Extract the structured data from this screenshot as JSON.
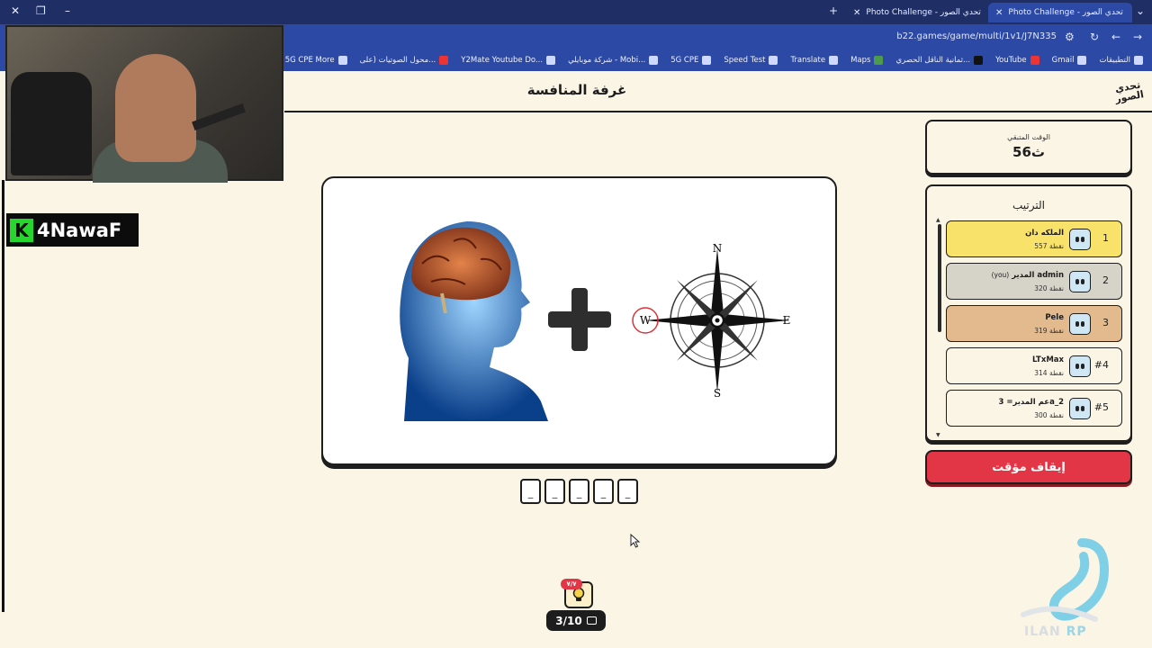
{
  "browser": {
    "tabs": [
      {
        "title": "Photo Challenge - تحدي الصور",
        "active": false
      },
      {
        "title": "Photo Challenge - تحدي الصور",
        "active": true
      }
    ],
    "url": "b22.games/game/multi/1v1/J7N335",
    "bookmarks": [
      "التطبيقات",
      "Gmail",
      "YouTube",
      "ثمانية الناقل الحصري...",
      "Maps",
      "Translate",
      "Speed Test",
      "5G CPE",
      "شركة موبايلي - Mobi...",
      "Y2Mate Youtube Do...",
      "محول الصوتيات (على...",
      "5G CPE More"
    ]
  },
  "stream": {
    "channel_name": "4NawaF",
    "badge_letter": "K"
  },
  "header": {
    "title": "غرفة المنافسة",
    "logo_text": "تحدي الصور"
  },
  "puzzle": {
    "images": [
      "brain-icon",
      "plus-icon",
      "compass-icon"
    ],
    "compass_labels": {
      "n": "N",
      "s": "S",
      "e": "E",
      "w": "W"
    },
    "slots": [
      "_",
      "_",
      "_",
      "_",
      "_"
    ]
  },
  "timer": {
    "label": "الوقت المتبقي",
    "value": "56ث"
  },
  "ranking": {
    "title": "الترتيب",
    "players": [
      {
        "position": "1",
        "name": "الملكه دان",
        "you": "",
        "score": "557 نقطة",
        "color": "#f8e26a"
      },
      {
        "position": "2",
        "name": "المدير admin",
        "you": "(you)",
        "score": "320 نقطة",
        "color": "#d6d3c8"
      },
      {
        "position": "3",
        "name": "Pele",
        "you": "",
        "score": "319 نقطة",
        "color": "#e3b98e"
      },
      {
        "position": "#4",
        "name": "LTxMax",
        "you": "",
        "score": "314 نقطة",
        "color": "#fbf5e6"
      },
      {
        "position": "#5",
        "name": "عم المدير= 3a_2",
        "you": "",
        "score": "300 نقطة",
        "color": "#fbf5e6"
      }
    ]
  },
  "controls": {
    "stop_timer": "إيقاف مؤقت",
    "hints_badge": "٧/٧",
    "progress": "3/10"
  },
  "watermark": {
    "text_a": "ILAN",
    "text_b": "RP"
  }
}
